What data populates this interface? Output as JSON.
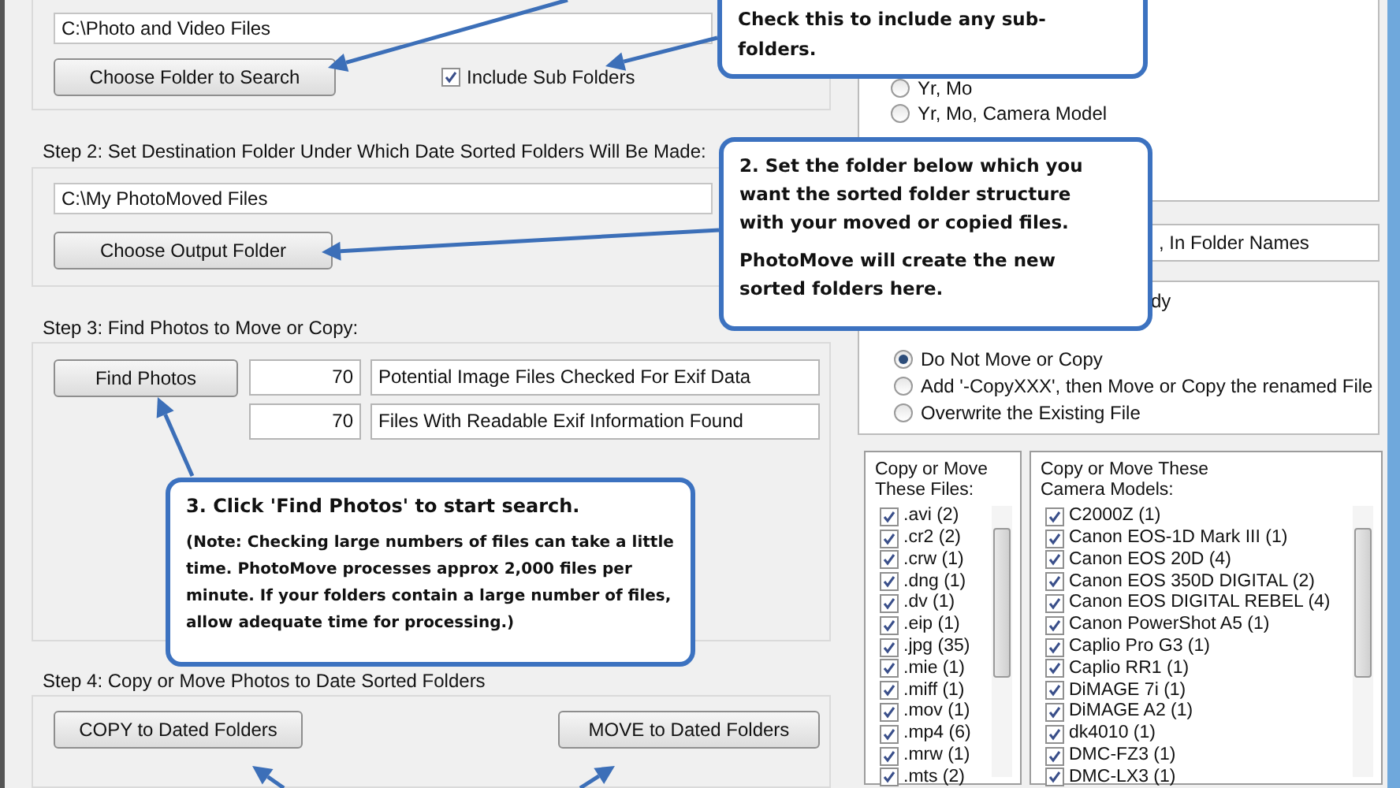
{
  "step1": {
    "path": "C:\\Photo and Video Files",
    "button": "Choose Folder to Search",
    "include_sub_folders": {
      "label": "Include Sub Folders",
      "checked": true
    }
  },
  "step2": {
    "heading": "Step 2: Set Destination Folder Under Which Date Sorted Folders Will Be Made:",
    "path": "C:\\My PhotoMoved Files",
    "button": "Choose Output Folder"
  },
  "step3": {
    "heading": "Step 3: Find Photos to Move or Copy:",
    "button": "Find Photos",
    "counts": [
      {
        "value": "70",
        "label": "Potential Image Files Checked For Exif Data"
      },
      {
        "value": "70",
        "label": "Files With Readable Exif Information Found"
      }
    ]
  },
  "step4": {
    "heading": "Step 4: Copy or Move Photos to Date Sorted Folders",
    "buttons": [
      "COPY to Dated Folders",
      "MOVE to Dated Folders"
    ]
  },
  "folder_structure_options": [
    {
      "label": "Yr, Mo",
      "selected": false
    },
    {
      "label": "Yr, Mo, Camera Model",
      "selected": false
    }
  ],
  "folder_names_option": ", In Folder Names",
  "duplicate_panel": {
    "heading_fragment": "dy",
    "options": [
      {
        "label": "Do Not Move or Copy",
        "selected": true
      },
      {
        "label": "Add '-CopyXXX', then Move or Copy the renamed File",
        "selected": false
      },
      {
        "label": "Overwrite the Existing File",
        "selected": false
      }
    ]
  },
  "file_types": {
    "title": "Copy or Move These Files:",
    "items": [
      {
        "label": ".avi (2)",
        "checked": true
      },
      {
        "label": ".cr2 (2)",
        "checked": true
      },
      {
        "label": ".crw (1)",
        "checked": true
      },
      {
        "label": ".dng (1)",
        "checked": true
      },
      {
        "label": ".dv (1)",
        "checked": true
      },
      {
        "label": ".eip (1)",
        "checked": true
      },
      {
        "label": ".jpg (35)",
        "checked": true
      },
      {
        "label": ".mie (1)",
        "checked": true
      },
      {
        "label": ".miff (1)",
        "checked": true
      },
      {
        "label": ".mov (1)",
        "checked": true
      },
      {
        "label": ".mp4 (6)",
        "checked": true
      },
      {
        "label": ".mrw (1)",
        "checked": true
      },
      {
        "label": ".mts (2)",
        "checked": true
      }
    ]
  },
  "camera_models": {
    "title": "Copy or Move These Camera Models:",
    "items": [
      {
        "label": "C2000Z (1)",
        "checked": true
      },
      {
        "label": "Canon EOS-1D Mark III (1)",
        "checked": true
      },
      {
        "label": "Canon EOS 20D (4)",
        "checked": true
      },
      {
        "label": "Canon EOS 350D DIGITAL (2)",
        "checked": true
      },
      {
        "label": "Canon EOS DIGITAL REBEL (4)",
        "checked": true
      },
      {
        "label": "Canon PowerShot A5 (1)",
        "checked": true
      },
      {
        "label": "Caplio Pro G3 (1)",
        "checked": true
      },
      {
        "label": "Caplio RR1 (1)",
        "checked": true
      },
      {
        "label": "DiMAGE 7i (1)",
        "checked": true
      },
      {
        "label": "DiMAGE A2 (1)",
        "checked": true
      },
      {
        "label": "dk4010 (1)",
        "checked": true
      },
      {
        "label": "DMC-FZ3 (1)",
        "checked": true
      },
      {
        "label": "DMC-LX3 (1)",
        "checked": true
      }
    ]
  },
  "callouts": [
    {
      "paragraphs": [
        "Check this to include any sub-folders."
      ]
    },
    {
      "paragraphs": [
        "2. Set the folder below which you want the sorted folder structure with your moved or copied files.",
        "PhotoMove will create the new sorted folders here."
      ]
    },
    {
      "paragraphs": [
        "3. Click 'Find Photos' to start search.",
        "(Note: Checking large numbers of files can take a little time. PhotoMove processes approx 2,000 files per minute. If your folders contain a large number of files, allow adequate time for processing.)"
      ]
    }
  ]
}
